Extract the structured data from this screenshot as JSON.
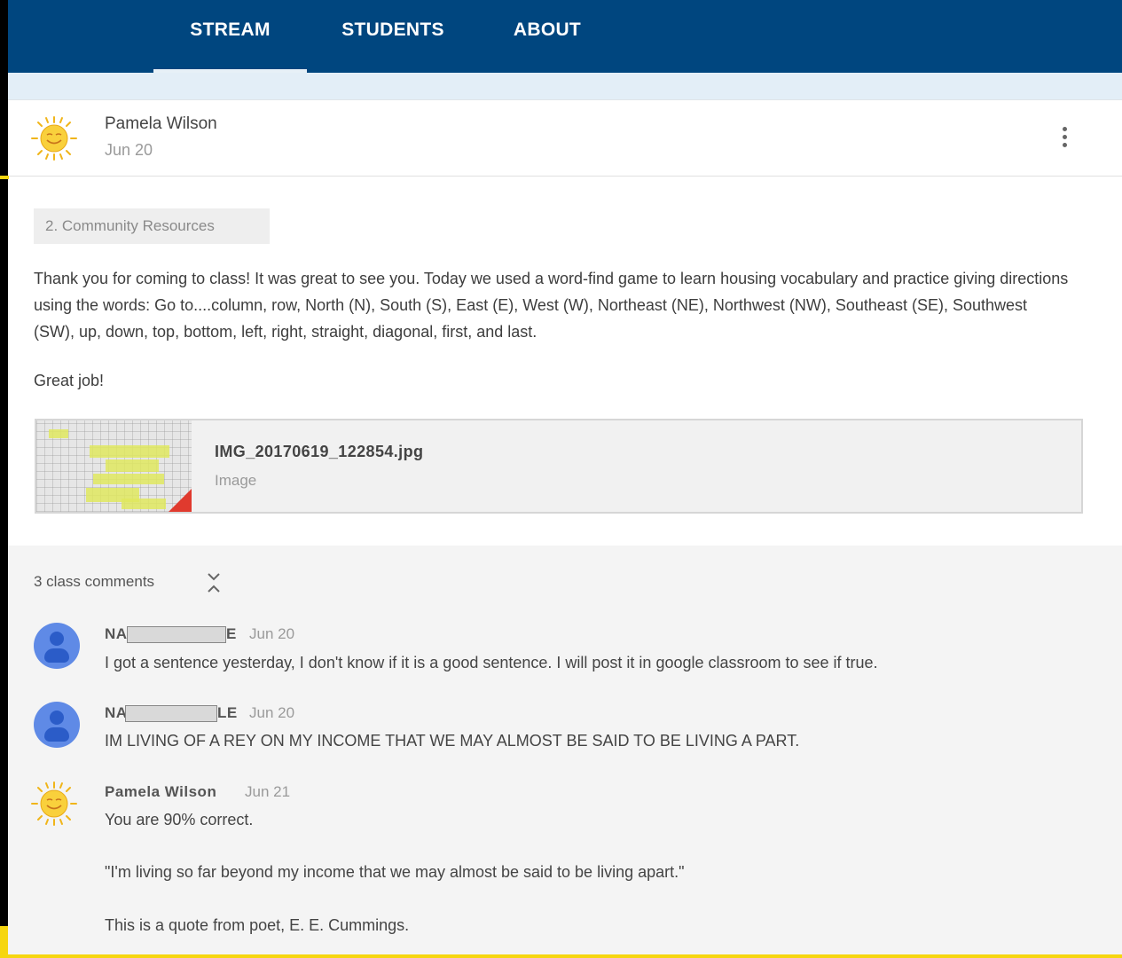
{
  "tabs": [
    {
      "label": "STREAM",
      "active": true
    },
    {
      "label": "STUDENTS",
      "active": false
    },
    {
      "label": "ABOUT",
      "active": false
    }
  ],
  "post": {
    "author": "Pamela Wilson",
    "date": "Jun 20",
    "topic": "2. Community Resources",
    "body": "Thank you for coming to class! It was great to see you. Today we used a word-find game to learn housing vocabulary and practice giving directions using the words: Go to....column, row, North (N), South (S), East (E), West (W), Northeast (NE), Northwest (NW), Southeast (SE), Southwest (SW), up, down, top, bottom, left, right, straight, diagonal, first, and last.",
    "closing": "Great job!",
    "attachment": {
      "filename": "IMG_20170619_122854.jpg",
      "type": "Image"
    }
  },
  "comments_header": "3 class comments",
  "comments": [
    {
      "name_start": "NA",
      "name_end": "E",
      "date": "Jun 20",
      "text": "I got a sentence yesterday, I don't know if it is a good sentence. I will post it in google classroom to see if true."
    },
    {
      "name_start": "NA",
      "name_end": "LE",
      "date": "Jun 20",
      "text": "IM LIVING OF A REY ON MY INCOME THAT WE MAY ALMOST BE SAID TO BE LIVING A PART."
    },
    {
      "name": "Pamela Wilson",
      "date": "Jun 21",
      "line1": "You are 90% correct.",
      "line2": "\"I'm living so far beyond my income that we may almost be said to be living apart.\"",
      "line3": "This is a quote from poet, E. E. Cummings."
    }
  ],
  "colors": {
    "header": "#00467f",
    "page_bg": "#e7f0f7",
    "comments_bg": "#f4f4f4",
    "avatar_blue": "#5f8ae6",
    "frame_yellow": "#f6d60f"
  },
  "icons": {
    "teacher_avatar": "sun-avatar-icon",
    "student_avatar": "person-avatar-icon",
    "menu": "more-vert-icon",
    "expand": "unfold-icon"
  }
}
